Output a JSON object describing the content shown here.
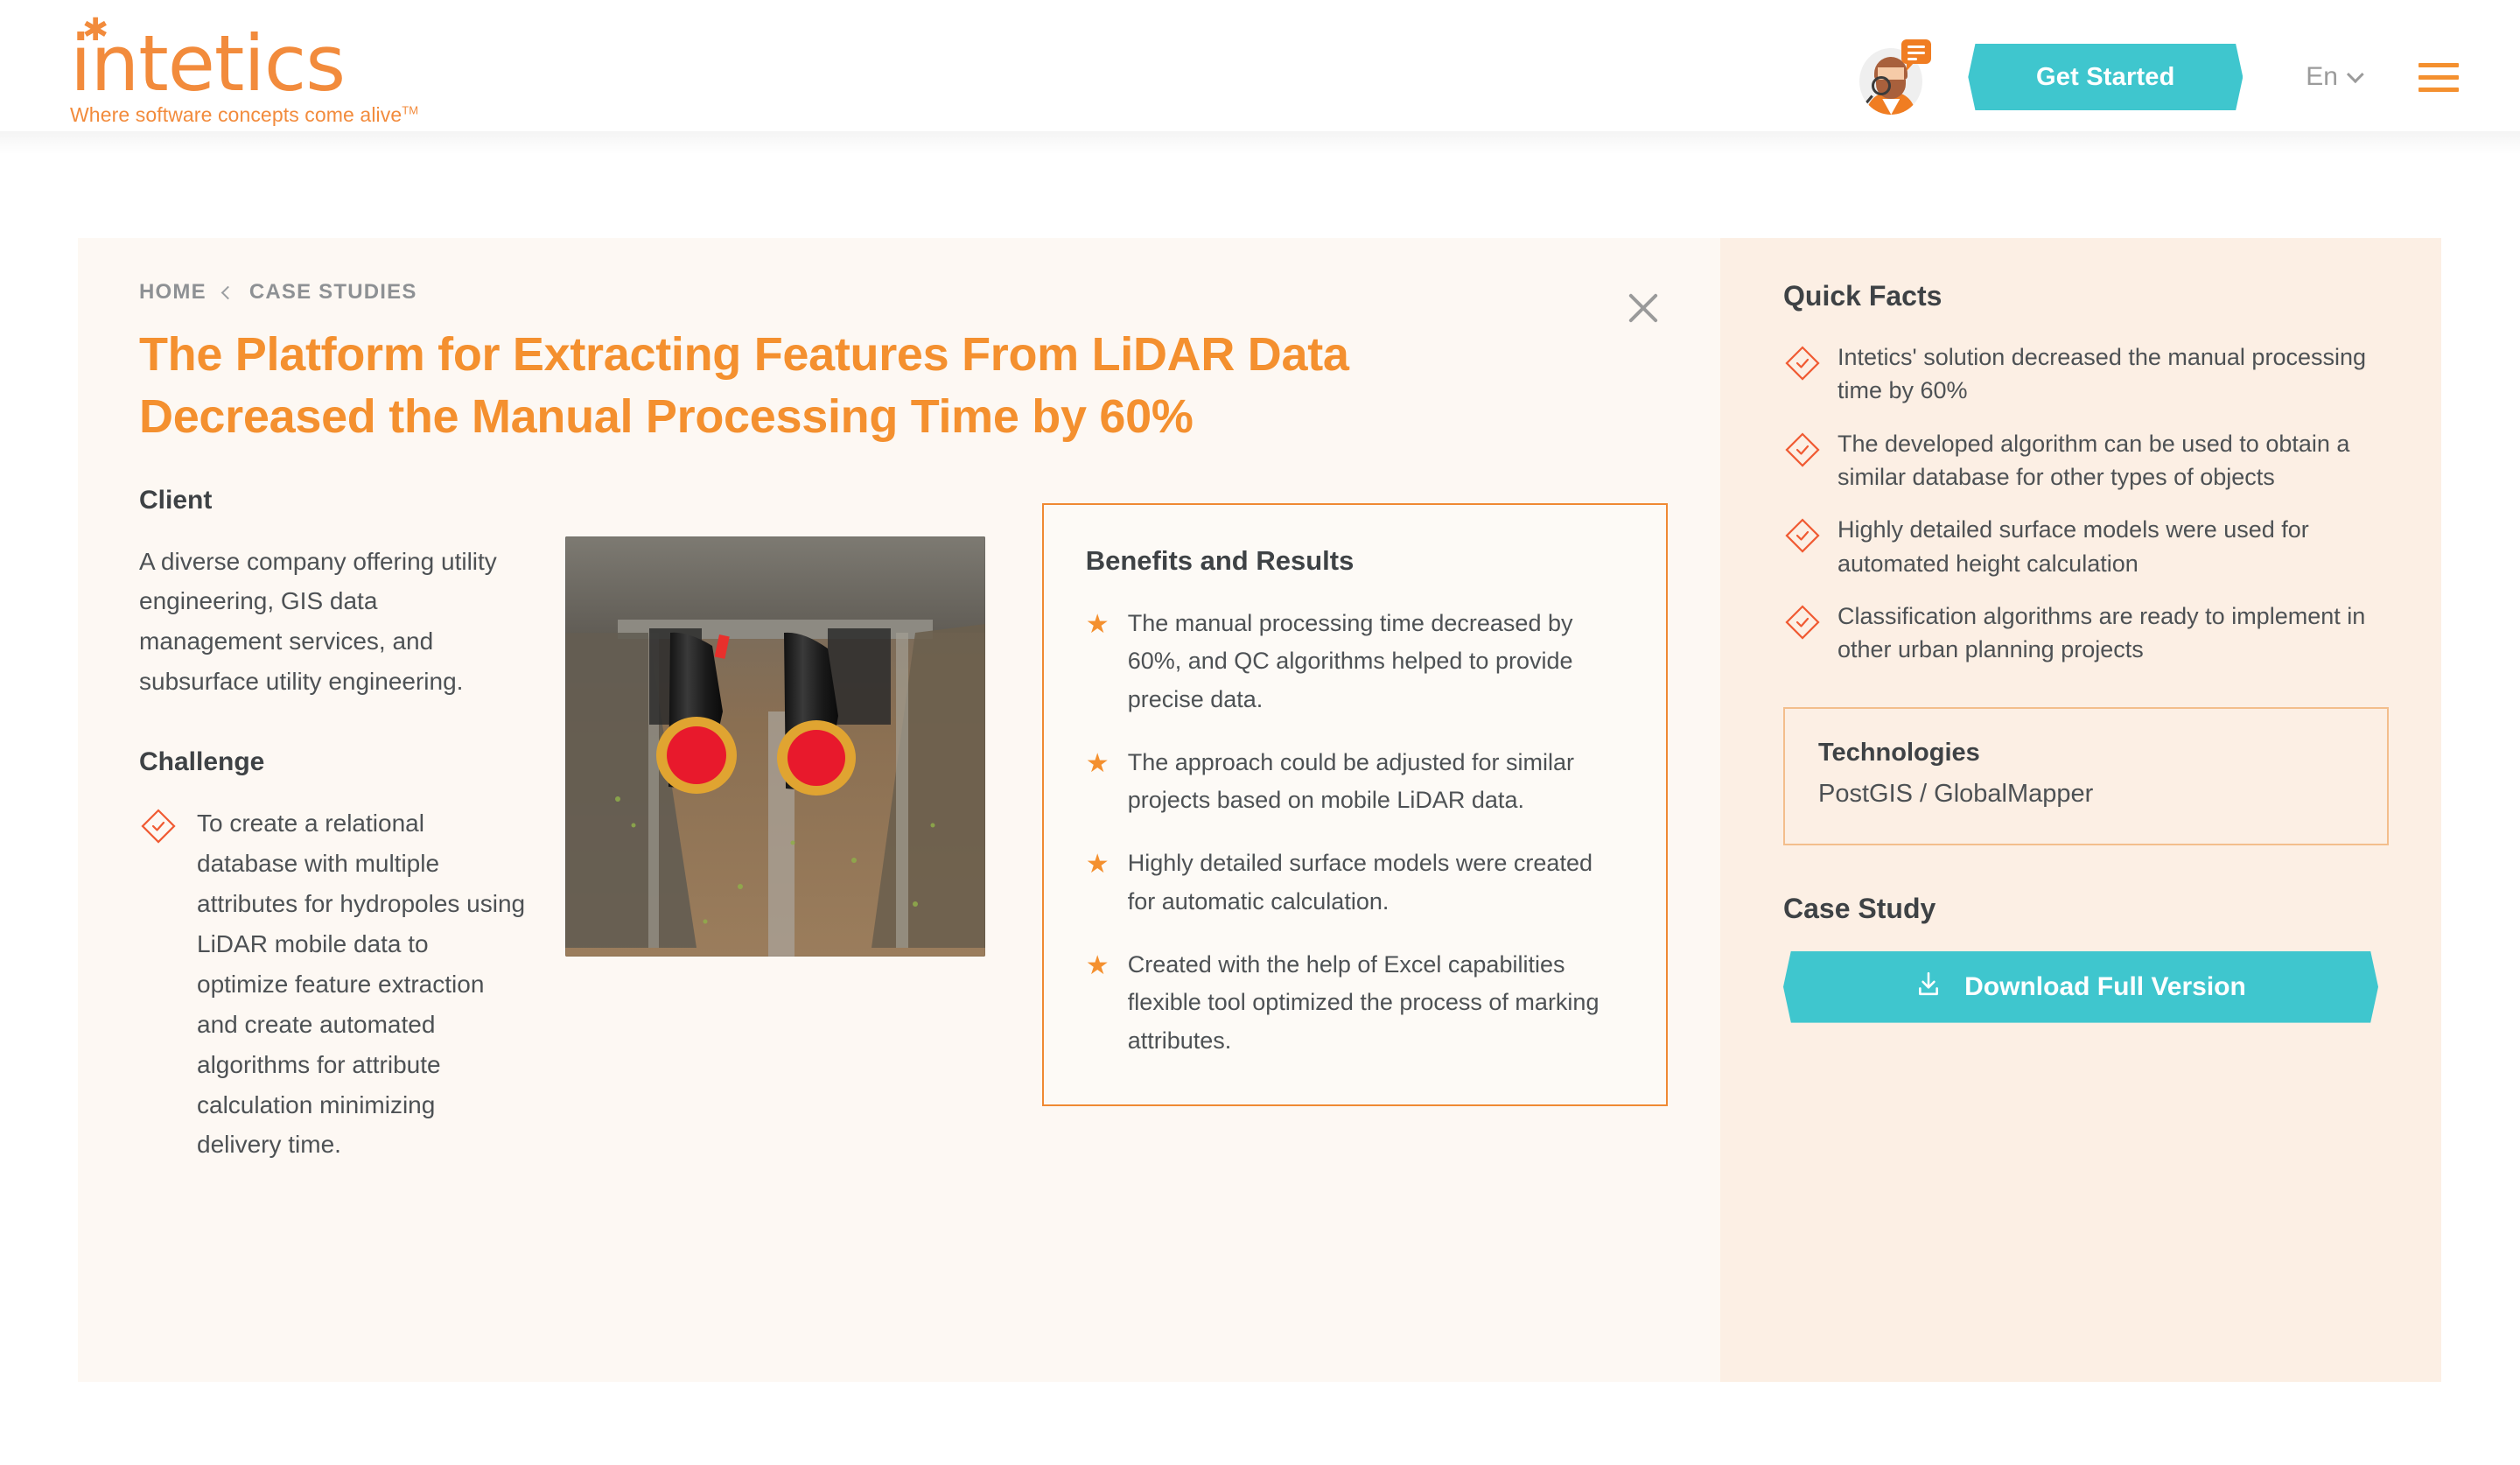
{
  "header": {
    "logo_word": "intetics",
    "logo_tagline": "Where software concepts come alive",
    "logo_tm": "TM",
    "cta_label": "Get Started",
    "lang_label": "En",
    "avatar_name": "support-agent-avatar",
    "menu_name": "hamburger-menu"
  },
  "breadcrumb": {
    "home": "HOME",
    "current": "CASE STUDIES"
  },
  "case": {
    "title": "The Platform for Extracting Features From LiDAR Data Decreased the Manual Processing Time by 60%",
    "client_heading": "Client",
    "client_text": "A diverse company offering utility engineering, GIS data management services, and subsurface utility engineering.",
    "challenge_heading": "Challenge",
    "challenge_items": [
      "To create a relational database with multiple attributes for hydropoles using LiDAR mobile data to optimize feature extraction and create automated algorithms for attribute calculation minimizing delivery time."
    ],
    "photo_caption": "construction-trench-pipes-photo"
  },
  "benefits": {
    "title": "Benefits and Results",
    "items": [
      "The manual processing time decreased by 60%, and QC algorithms helped to provide precise data.",
      "The approach could be adjusted for similar projects based on mobile LiDAR data.",
      "Highly detailed surface models were created for automatic calculation.",
      "Created with the help of Excel capabilities flexible tool optimized the process of marking attributes."
    ]
  },
  "sidebar": {
    "quick_facts_title": "Quick Facts",
    "quick_facts": [
      "Intetics' solution decreased the manual processing time by 60%",
      "The developed algorithm can be used to obtain a similar database for other types of objects",
      "Highly detailed surface models were used for automated height calculation",
      "Classification algorithms are ready to implement in other urban planning projects"
    ],
    "technologies_heading": "Technologies",
    "technologies_value": "PostGIS / GlobalMapper",
    "case_study_title": "Case Study",
    "download_label": "Download Full Version"
  },
  "colors": {
    "brand_orange": "#F4902F",
    "accent_teal": "#3FC6CE",
    "diamond_red": "#F05A32",
    "panel_bg": "#FDF8F3",
    "sidebar_bg": "#FCEFE4",
    "text_dark": "#3E4245",
    "text_body": "#4D5154",
    "muted": "#8E9194"
  }
}
